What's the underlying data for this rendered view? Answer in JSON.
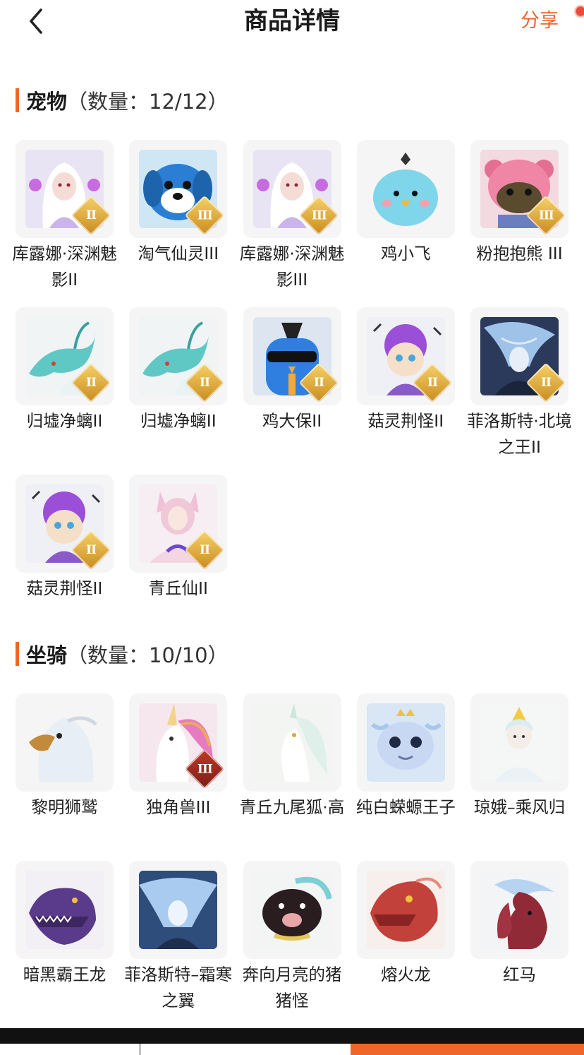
{
  "header": {
    "title": "商品详情",
    "share_label": "分享"
  },
  "pets": {
    "title": "宠物",
    "count": "（数量：12/12）",
    "items": [
      {
        "name": "库露娜·深渊魅影II",
        "badge": "II",
        "art": "fairy"
      },
      {
        "name": "淘气仙灵III",
        "badge": "III",
        "art": "bluedog"
      },
      {
        "name": "库露娜·深渊魅影III",
        "badge": "III",
        "art": "fairy"
      },
      {
        "name": "鸡小飞",
        "badge": "",
        "art": "bluebird"
      },
      {
        "name": "粉抱抱熊 III",
        "badge": "III",
        "art": "bear"
      },
      {
        "name": "归墟净螭II",
        "badge": "II",
        "art": "dragon"
      },
      {
        "name": "归墟净螭II",
        "badge": "II",
        "art": "dragon"
      },
      {
        "name": "鸡大保II",
        "badge": "II",
        "art": "coolbird"
      },
      {
        "name": "菇灵荆怪II",
        "badge": "II",
        "art": "purple"
      },
      {
        "name": "菲洛斯特·北境之王II",
        "badge": "II",
        "art": "icelord"
      },
      {
        "name": "菇灵荆怪II",
        "badge": "II",
        "art": "purple"
      },
      {
        "name": "青丘仙II",
        "badge": "II",
        "art": "fox_girl"
      }
    ]
  },
  "mounts": {
    "title": "坐骑",
    "count": "（数量：10/10）",
    "items": [
      {
        "name": "黎明狮鹫",
        "badge": "",
        "art": "griffin"
      },
      {
        "name": "独角兽III",
        "badge": "III",
        "art": "unicorn"
      },
      {
        "name": "青丘九尾狐·高",
        "badge": "",
        "art": "ninetail"
      },
      {
        "name": "纯白蝾螈王子",
        "badge": "",
        "art": "axolotl"
      },
      {
        "name": "琼娥–乘风归",
        "badge": "",
        "art": "goddess"
      },
      {
        "name": "暗黑霸王龙",
        "badge": "",
        "art": "trex"
      },
      {
        "name": "菲洛斯特–霜寒之翼",
        "badge": "",
        "art": "icewing"
      },
      {
        "name": "奔向月亮的猪猪怪",
        "badge": "",
        "art": "pig"
      },
      {
        "name": "熔火龙",
        "badge": "",
        "art": "firedragon"
      },
      {
        "name": "红马",
        "badge": "",
        "art": "horse"
      }
    ]
  },
  "colors": {
    "accent": "#f0652a",
    "badge_gold": "#e0a93a",
    "badge_red": "#a52a1f",
    "tile_bg": "#f5f5f5"
  },
  "icons": {
    "back": "chevron-left-icon"
  }
}
